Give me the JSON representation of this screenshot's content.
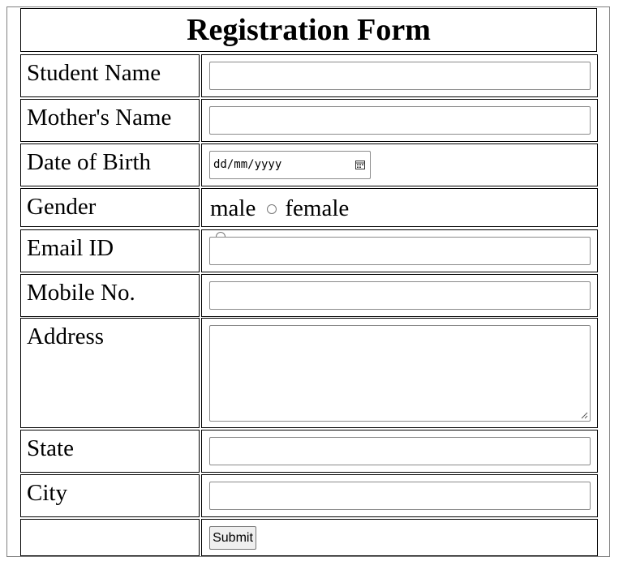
{
  "form": {
    "title": "Registration Form",
    "labels": {
      "student_name": "Student Name",
      "mothers_name": "Mother's Name",
      "dob": "Date of Birth",
      "gender": "Gender",
      "email": "Email ID",
      "mobile": "Mobile No.",
      "address": "Address",
      "state": "State",
      "city": "City"
    },
    "dob_placeholder": "dd/mm/yyyy",
    "gender_options": {
      "male": "male",
      "female": "female"
    },
    "submit_label": "Submit"
  },
  "icons": {
    "date_picker": "calendar-icon",
    "radio": "radio-icon",
    "resize": "resize-handle-icon"
  }
}
